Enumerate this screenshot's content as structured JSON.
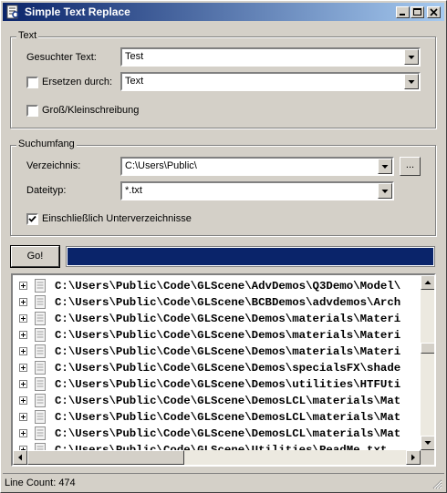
{
  "window": {
    "title": "Simple Text Replace"
  },
  "text_group": {
    "legend": "Text",
    "search_label": "Gesuchter Text:",
    "search_value": "Test",
    "replace_label": "Ersetzen durch:",
    "replace_checked": false,
    "replace_value": "Text",
    "case_label": "Groß/Kleinschreibung",
    "case_checked": false
  },
  "scope_group": {
    "legend": "Suchumfang",
    "dir_label": "Verzeichnis:",
    "dir_value": "C:\\Users\\Public\\",
    "browse_label": "...",
    "type_label": "Dateityp:",
    "type_value": "*.txt",
    "subdirs_label": "Einschließlich Unterverzeichnisse",
    "subdirs_checked": true
  },
  "go_button": "Go!",
  "progress": 1.0,
  "results": [
    "C:\\Users\\Public\\Code\\GLScene\\AdvDemos\\Q3Demo\\Model\\",
    "C:\\Users\\Public\\Code\\GLScene\\BCBDemos\\advdemos\\Arch",
    "C:\\Users\\Public\\Code\\GLScene\\Demos\\materials\\Materi",
    "C:\\Users\\Public\\Code\\GLScene\\Demos\\materials\\Materi",
    "C:\\Users\\Public\\Code\\GLScene\\Demos\\materials\\Materi",
    "C:\\Users\\Public\\Code\\GLScene\\Demos\\specialsFX\\shade",
    "C:\\Users\\Public\\Code\\GLScene\\Demos\\utilities\\HTFUti",
    "C:\\Users\\Public\\Code\\GLScene\\DemosLCL\\materials\\Mat",
    "C:\\Users\\Public\\Code\\GLScene\\DemosLCL\\materials\\Mat",
    "C:\\Users\\Public\\Code\\GLScene\\DemosLCL\\materials\\Mat",
    "C:\\Users\\Public\\Code\\GLScene\\Utilities\\ReadMe.txt"
  ],
  "status": "Line Count: 474",
  "icons": {
    "app": "app-icon",
    "minimize": "minimize-icon",
    "maximize": "maximize-icon",
    "close": "close-icon",
    "dropdown": "chevron-down-icon",
    "expand": "plus-icon",
    "file": "document-icon"
  }
}
